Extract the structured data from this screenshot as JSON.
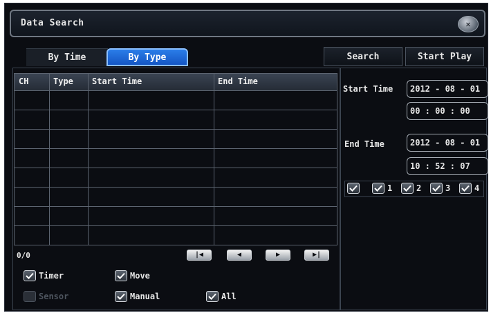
{
  "title": "Data Search",
  "tabs": [
    {
      "label": "By Time",
      "active": false
    },
    {
      "label": "By Type",
      "active": true
    }
  ],
  "buttons": {
    "search": "Search",
    "start_play": "Start Play"
  },
  "table": {
    "columns": [
      "CH",
      "Type",
      "Start Time",
      "End Time"
    ],
    "rows": []
  },
  "pagination": {
    "count": "0/0"
  },
  "nav_icons": [
    "first-page-icon",
    "previous-page-icon",
    "next-page-icon",
    "last-page-icon"
  ],
  "type_filters": [
    {
      "label": "Timer",
      "checked": true,
      "enabled": true
    },
    {
      "label": "Move",
      "checked": true,
      "enabled": true
    },
    {
      "label": "Sensor",
      "checked": false,
      "enabled": false
    },
    {
      "label": "Manual",
      "checked": true,
      "enabled": true
    },
    {
      "label": "All",
      "checked": true,
      "enabled": true
    }
  ],
  "start": {
    "label": "Start Time",
    "date": "2012 - 08 - 01",
    "time": "00 : 00 : 00"
  },
  "end": {
    "label": "End Time",
    "date": "2012 - 08 - 01",
    "time": "10 : 52 : 07"
  },
  "channels": [
    {
      "label": "",
      "checked": true
    },
    {
      "label": "1",
      "checked": true
    },
    {
      "label": "2",
      "checked": true
    },
    {
      "label": "3",
      "checked": true
    },
    {
      "label": "4",
      "checked": true
    }
  ],
  "colors": {
    "accent": "#1f6fe0",
    "background": "#0b0d12",
    "text": "#e6e6e6"
  }
}
